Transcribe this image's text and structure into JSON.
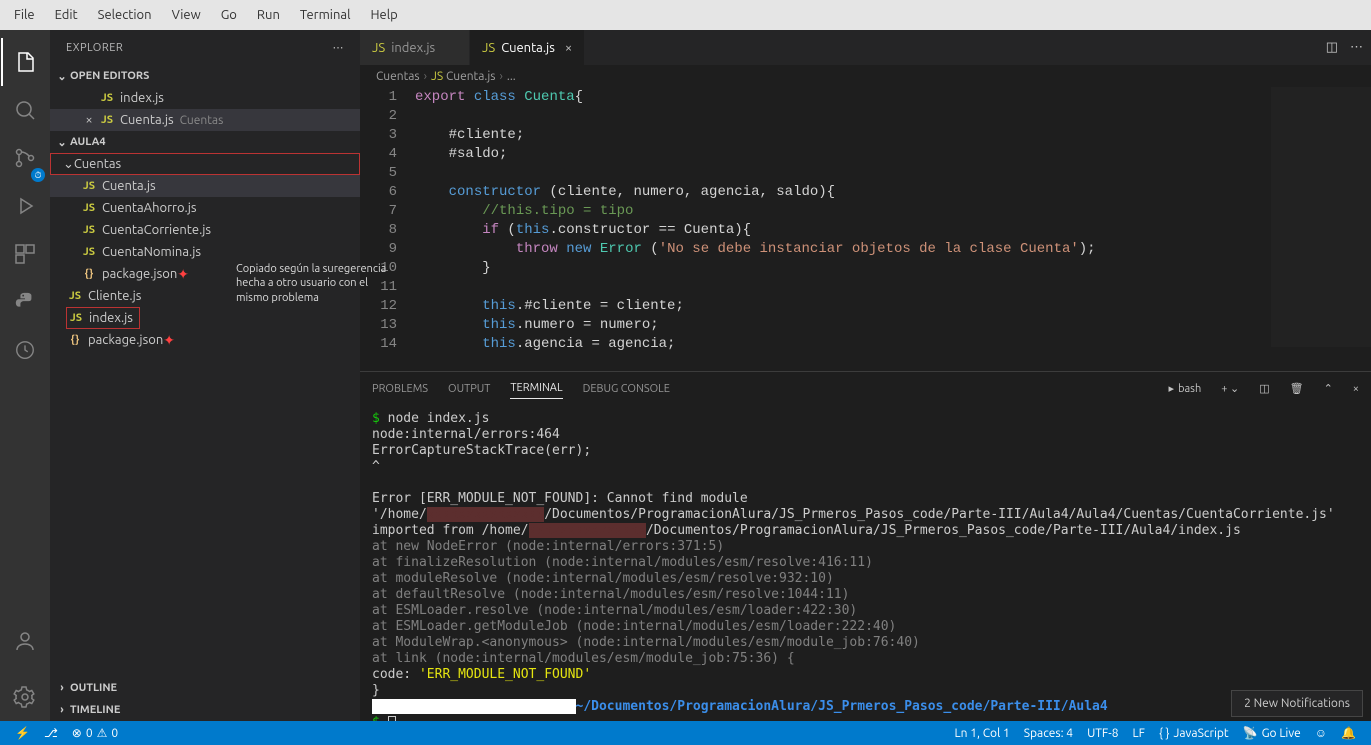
{
  "menu": [
    "File",
    "Edit",
    "Selection",
    "View",
    "Go",
    "Run",
    "Terminal",
    "Help"
  ],
  "sidebar": {
    "title": "EXPLORER",
    "openEditors": {
      "label": "OPEN EDITORS",
      "items": [
        {
          "icon": "JS",
          "name": "index.js",
          "closable": false
        },
        {
          "icon": "JS",
          "name": "Cuenta.js",
          "dir": "Cuentas",
          "closable": true,
          "active": true
        }
      ]
    },
    "workspace": {
      "label": "AULA4",
      "folder": {
        "name": "Cuentas",
        "boxed": true
      },
      "folderItems": [
        {
          "icon": "JS",
          "name": "Cuenta.js",
          "active": true
        },
        {
          "icon": "JS",
          "name": "CuentaAhorro.js"
        },
        {
          "icon": "JS",
          "name": "CuentaCorriente.js"
        },
        {
          "icon": "JS",
          "name": "CuentaNomina.js"
        },
        {
          "icon": "{}",
          "name": "package.json",
          "star": true
        }
      ],
      "rootItems": [
        {
          "icon": "JS",
          "name": "Cliente.js"
        },
        {
          "icon": "JS",
          "name": "index.js",
          "boxed": true
        },
        {
          "icon": "{}",
          "name": "package.json",
          "star": true
        }
      ]
    },
    "outline": "OUTLINE",
    "timeline": "TIMELINE",
    "annotation": "Copiado según la suregerencia hecha a otro usuario con el mismo problema"
  },
  "tabs": [
    {
      "icon": "JS",
      "name": "index.js",
      "active": false
    },
    {
      "icon": "JS",
      "name": "Cuenta.js",
      "active": true,
      "close": true
    }
  ],
  "breadcrumbs": [
    "Cuentas",
    "Cuenta.js",
    "..."
  ],
  "code": {
    "linesCount": 14,
    "l1": "export",
    "l1b": "class",
    "l1c": "Cuenta",
    "l1d": "{",
    "l3": "#cliente;",
    "l4": "#saldo;",
    "l6a": "constructor",
    "l6b": " (cliente, numero, agencia, saldo){",
    "l7": "//this.tipo = tipo",
    "l8a": "if",
    "l8b": " (",
    "l8c": "this",
    "l8d": ".constructor == Cuenta){",
    "l9a": "throw",
    "l9b": "new",
    "l9c": "Error",
    "l9d": " (",
    "l9e": "'No se debe instanciar objetos de la clase Cuenta'",
    "l9f": ");",
    "l10": "}",
    "l12a": "this",
    "l12b": ".#cliente = cliente;",
    "l13a": "this",
    "l13b": ".numero = numero;",
    "l14a": "this",
    "l14b": ".agencia = agencia;"
  },
  "panel": {
    "tabs": [
      "PROBLEMS",
      "OUTPUT",
      "TERMINAL",
      "DEBUG CONSOLE"
    ],
    "activeTab": 2,
    "shell": "bash",
    "terminal": {
      "cmd": "node index.js",
      "l1": "node:internal/errors:464",
      "l2": "    ErrorCaptureStackTrace(err);",
      "l3": "    ^",
      "err1": "Error [ERR_MODULE_NOT_FOUND]: Cannot find module '/home/",
      "err1b": "/Documentos/ProgramacionAlura/JS_Prmeros_Pasos_code/Parte-III/Aula4/Aula4/Cuentas/CuentaCorriente.js' imported from /home/",
      "err1c": "/Documentos/ProgramacionAlura/JS_Prmeros_Pasos_code/Parte-III/Aula4/index.js",
      "traces": [
        "    at new NodeError (node:internal/errors:371:5)",
        "    at finalizeResolution (node:internal/modules/esm/resolve:416:11)",
        "    at moduleResolve (node:internal/modules/esm/resolve:932:10)",
        "    at defaultResolve (node:internal/modules/esm/resolve:1044:11)",
        "    at ESMLoader.resolve (node:internal/modules/esm/loader:422:30)",
        "    at ESMLoader.getModuleJob (node:internal/modules/esm/loader:222:40)",
        "    at ModuleWrap.<anonymous> (node:internal/modules/esm/module_job:76:40)",
        "    at link (node:internal/modules/esm/module_job:75:36) {"
      ],
      "codeline": "  code: ",
      "codeval": "'ERR_MODULE_NOT_FOUND'",
      "close": "}",
      "cwd": "~/Documentos/ProgramacionAlura/JS_Prmeros_Pasos_code/Parte-III/Aula4"
    }
  },
  "status": {
    "remote": "⚡",
    "branch": "⎇",
    "errors": "0",
    "warnings": "0",
    "lncol": "Ln 1, Col 1",
    "spaces": "Spaces: 4",
    "encoding": "UTF-8",
    "eol": "LF",
    "lang": "JavaScript",
    "golive": "Go Live",
    "bell": "🔔"
  },
  "notification": "2 New Notifications"
}
